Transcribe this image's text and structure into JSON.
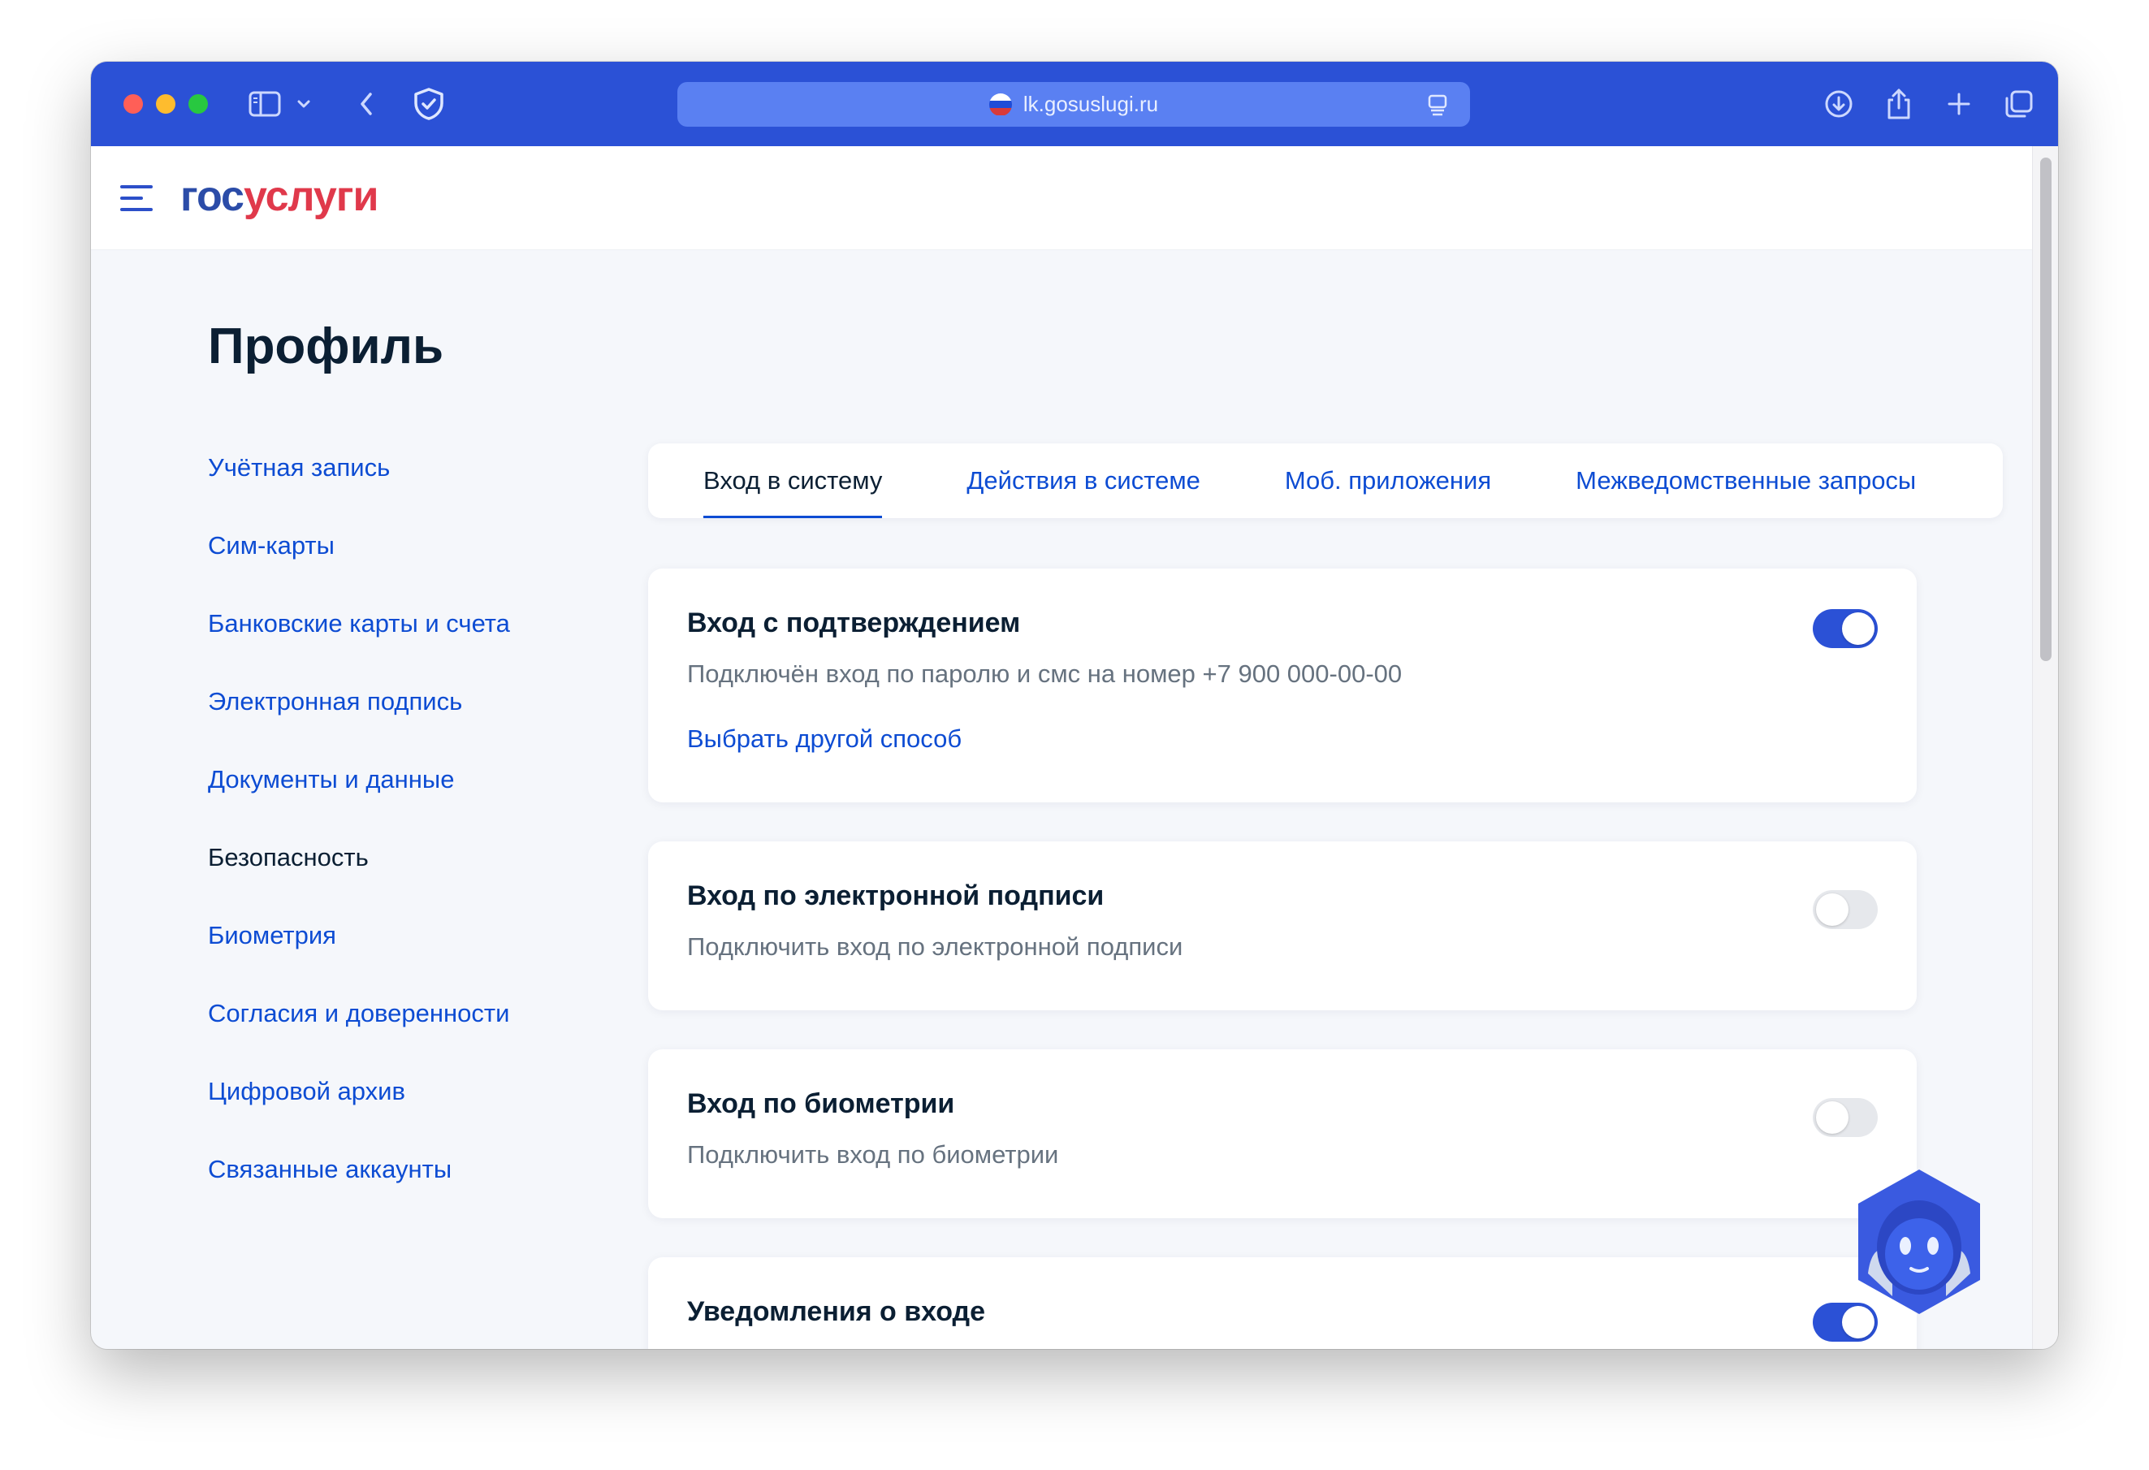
{
  "browser": {
    "url": "lk.gosuslugi.ru"
  },
  "logo": {
    "part1": "гос",
    "part2": "услуги"
  },
  "page": {
    "title": "Профиль"
  },
  "sidebar": {
    "items": [
      {
        "label": "Учётная запись",
        "active": false
      },
      {
        "label": "Сим-карты",
        "active": false
      },
      {
        "label": "Банковские карты и счета",
        "active": false
      },
      {
        "label": "Электронная подпись",
        "active": false
      },
      {
        "label": "Документы и данные",
        "active": false
      },
      {
        "label": "Безопасность",
        "active": true
      },
      {
        "label": "Биометрия",
        "active": false
      },
      {
        "label": "Согласия и доверенности",
        "active": false
      },
      {
        "label": "Цифровой архив",
        "active": false
      },
      {
        "label": "Связанные аккаунты",
        "active": false
      }
    ]
  },
  "tabs": [
    {
      "label": "Вход в систему",
      "active": true
    },
    {
      "label": "Действия в системе",
      "active": false
    },
    {
      "label": "Моб. приложения",
      "active": false
    },
    {
      "label": "Межведомственные запросы",
      "active": false
    }
  ],
  "cards": [
    {
      "title": "Вход с подтверждением",
      "description": "Подключён вход по паролю и смс на номер +7 900 000-00-00",
      "link": "Выбрать другой способ",
      "enabled": true
    },
    {
      "title": "Вход по электронной подписи",
      "description": "Подключить вход по электронной подписи",
      "enabled": false
    },
    {
      "title": "Вход по биометрии",
      "description": "Подключить вход по биометрии",
      "enabled": false
    },
    {
      "title": "Уведомления о входе",
      "enabled": true
    }
  ],
  "colors": {
    "toolbar": "#2b51d6",
    "link": "#0d4cd3",
    "text": "#0b1f33",
    "toggle_on": "#2b51d6"
  },
  "icons": [
    "sidebar-icon",
    "chevron-down-icon",
    "back-icon",
    "shield-icon",
    "reader-icon",
    "download-icon",
    "share-icon",
    "plus-icon",
    "tabs-icon",
    "menu-icon",
    "assistant-robot-icon"
  ]
}
